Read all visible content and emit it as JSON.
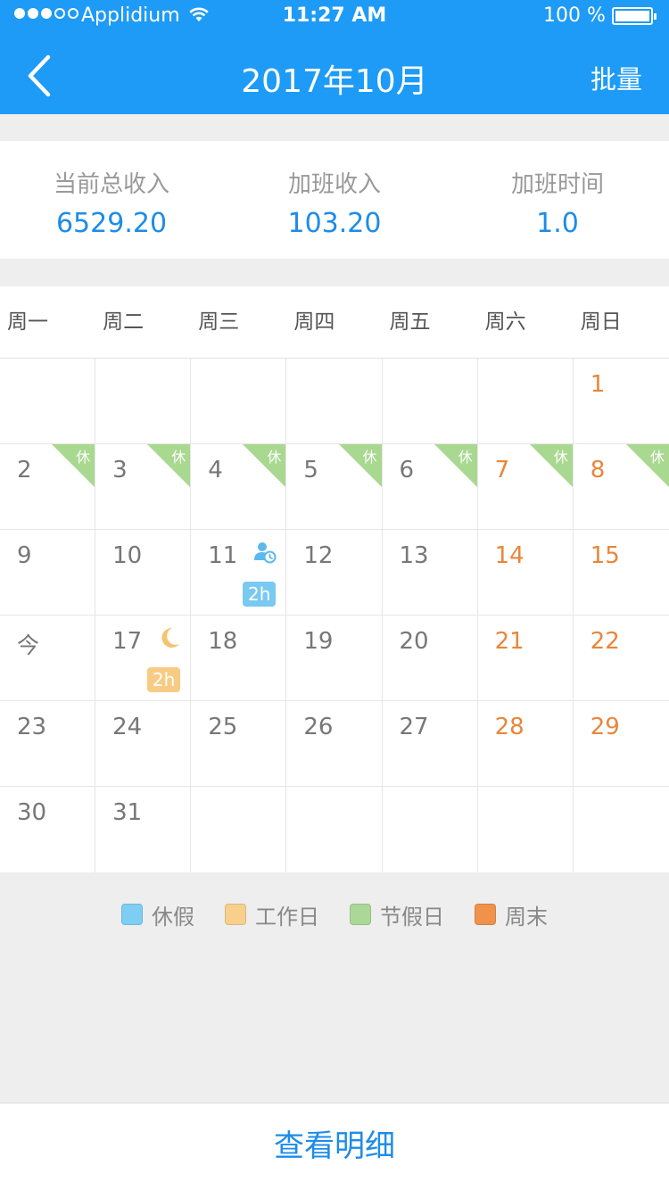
{
  "status_bar": {
    "carrier": "Applidium",
    "time": "11:27 AM",
    "battery": "100 %",
    "signal_bars_filled": 3,
    "signal_bars_total": 5
  },
  "nav": {
    "title": "2017年10月",
    "batch_label": "批量"
  },
  "summary": [
    {
      "label": "当前总收入",
      "value": "6529.20"
    },
    {
      "label": "加班收入",
      "value": "103.20"
    },
    {
      "label": "加班时间",
      "value": "1.0"
    }
  ],
  "calendar": {
    "weekdays": [
      "周一",
      "周二",
      "周三",
      "周四",
      "周五",
      "周六",
      "周日"
    ],
    "days": [
      {
        "label": ""
      },
      {
        "label": ""
      },
      {
        "label": ""
      },
      {
        "label": ""
      },
      {
        "label": ""
      },
      {
        "label": ""
      },
      {
        "label": "1",
        "weekend": true
      },
      {
        "label": "2",
        "tag": "休"
      },
      {
        "label": "3",
        "tag": "休"
      },
      {
        "label": "4",
        "tag": "休"
      },
      {
        "label": "5",
        "tag": "休"
      },
      {
        "label": "6",
        "tag": "休"
      },
      {
        "label": "7",
        "weekend": true,
        "tag": "休"
      },
      {
        "label": "8",
        "weekend": true,
        "tag": "休"
      },
      {
        "label": "9"
      },
      {
        "label": "10"
      },
      {
        "label": "11",
        "icon": "person-clock-icon",
        "badge": "2h",
        "badge_color": "blue"
      },
      {
        "label": "12"
      },
      {
        "label": "13"
      },
      {
        "label": "14",
        "weekend": true
      },
      {
        "label": "15",
        "weekend": true
      },
      {
        "label": "今",
        "today": true
      },
      {
        "label": "17",
        "icon": "moon-icon",
        "badge": "2h",
        "badge_color": "orange"
      },
      {
        "label": "18"
      },
      {
        "label": "19"
      },
      {
        "label": "20"
      },
      {
        "label": "21",
        "weekend": true
      },
      {
        "label": "22",
        "weekend": true
      },
      {
        "label": "23"
      },
      {
        "label": "24"
      },
      {
        "label": "25"
      },
      {
        "label": "26"
      },
      {
        "label": "27"
      },
      {
        "label": "28",
        "weekend": true
      },
      {
        "label": "29",
        "weekend": true
      },
      {
        "label": "30"
      },
      {
        "label": "31"
      },
      {
        "label": ""
      },
      {
        "label": ""
      },
      {
        "label": ""
      },
      {
        "label": ""
      },
      {
        "label": ""
      }
    ]
  },
  "legend": [
    {
      "label": "休假",
      "color": "#7ecef4"
    },
    {
      "label": "工作日",
      "color": "#f8d08c"
    },
    {
      "label": "节假日",
      "color": "#acd897"
    },
    {
      "label": "周末",
      "color": "#f0924a"
    }
  ],
  "footer": {
    "detail_label": "查看明细"
  }
}
